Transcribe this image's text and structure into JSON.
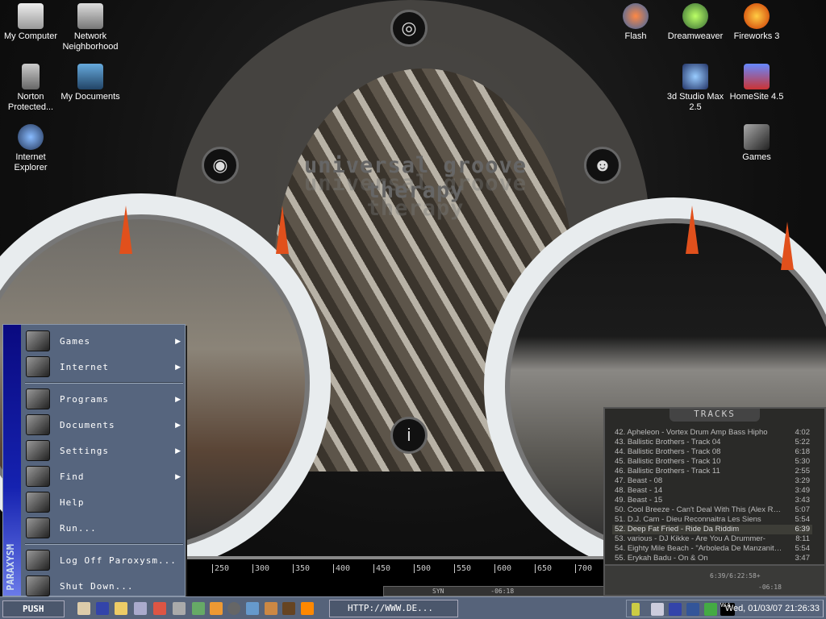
{
  "wallpaper": {
    "title": "universal groove therapy"
  },
  "desktop_icons": [
    {
      "label": "My Computer"
    },
    {
      "label": "Network Neighborhood"
    },
    {
      "label": "Norton Protected..."
    },
    {
      "label": "My Documents"
    },
    {
      "label": "Internet Explorer"
    },
    {
      "label": "Flash"
    },
    {
      "label": "Dreamweaver"
    },
    {
      "label": "Fireworks 3"
    },
    {
      "label": "3d Studio Max 2.5"
    },
    {
      "label": "HomeSite 4.5"
    },
    {
      "label": "Games"
    }
  ],
  "ruler": {
    "ticks": [
      "250",
      "300",
      "350",
      "400",
      "450",
      "500",
      "550",
      "600",
      "650",
      "700"
    ]
  },
  "mini_player": {
    "logo": "SYN",
    "time": "-06:18"
  },
  "start_menu": {
    "brand": "PARAXYSM",
    "items": [
      {
        "label": "Games",
        "submenu": true
      },
      {
        "label": "Internet",
        "submenu": true
      },
      {
        "label": "Programs",
        "submenu": true
      },
      {
        "label": "Documents",
        "submenu": true
      },
      {
        "label": "Settings",
        "submenu": true
      },
      {
        "label": "Find",
        "submenu": true
      },
      {
        "label": "Help",
        "submenu": false
      },
      {
        "label": "Run...",
        "submenu": false
      },
      {
        "label": "Log Off Paroxysm...",
        "submenu": false
      },
      {
        "label": "Shut Down...",
        "submenu": false
      }
    ]
  },
  "tracks": {
    "title": "TRACKS",
    "selected": "52",
    "rows": [
      {
        "n": "42. Apheleon - Vortex Drum Amp Bass Hipho",
        "t": "4:02"
      },
      {
        "n": "43. Ballistic Brothers - Track  04",
        "t": "5:22"
      },
      {
        "n": "44. Ballistic Brothers - Track  08",
        "t": "6:18"
      },
      {
        "n": "45. Ballistic Brothers - Track 10",
        "t": "5:30"
      },
      {
        "n": "46. Ballistic Brothers - Track 11",
        "t": "2:55"
      },
      {
        "n": "47. Beast - 08",
        "t": "3:29"
      },
      {
        "n": "48. Beast - 14",
        "t": "3:49"
      },
      {
        "n": "49. Beast - 15",
        "t": "3:43"
      },
      {
        "n": "50. Cool Breeze - Can't Deal With This (Alex Reece...",
        "t": "5:07"
      },
      {
        "n": "51. D.J. Cam - Dieu Reconnaitra Les Siens",
        "t": "5:54"
      },
      {
        "n": "52. Deep Fat Fried - Ride Da Riddim",
        "t": "6:39"
      },
      {
        "n": "53. various - DJ Kikke - Are You A Drummer-",
        "t": "8:11"
      },
      {
        "n": "54. Eighty Mile Beach - \"Arboleda De Manzanitas\"(...",
        "t": "5:54"
      },
      {
        "n": "55. Erykah Badu - On & On",
        "t": "3:47"
      }
    ],
    "total_time": "6:39/6:22:58+",
    "remaining": "-06:18"
  },
  "taskbar": {
    "start_label": "PUSH",
    "task_label": "HTTP://WWW.DE...",
    "clock": "Wed, 01/03/07 21:26:33",
    "tray_label": "W A"
  }
}
